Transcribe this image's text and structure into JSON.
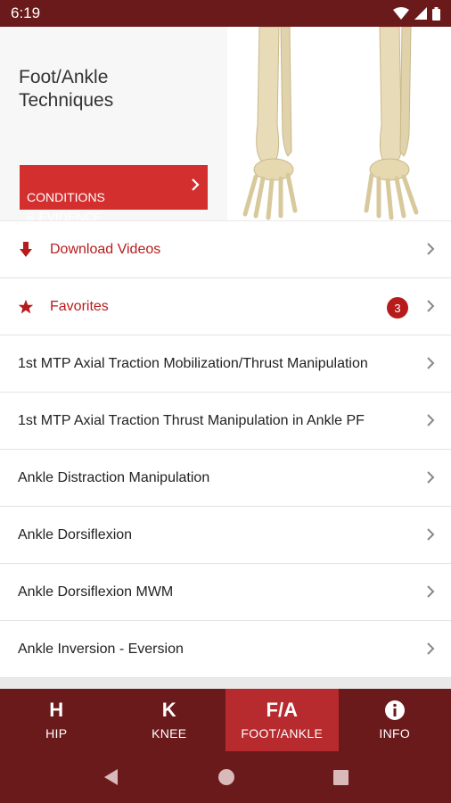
{
  "status_bar": {
    "time": "6:19",
    "icons": [
      "wifi-icon",
      "signal-icon",
      "battery-icon"
    ]
  },
  "hero": {
    "title": "Foot/Ankle\nTechniques",
    "button_label": "CONDITIONS\n& EVIDENCE"
  },
  "list": {
    "download_label": "Download Videos",
    "favorites_label": "Favorites",
    "favorites_count": "3",
    "items": [
      "1st MTP Axial Traction Mobilization/Thrust Manipulation",
      "1st MTP Axial Traction Thrust Manipulation in Ankle PF",
      "Ankle Distraction Manipulation",
      "Ankle Dorsiflexion",
      "Ankle Dorsiflexion MWM",
      "Ankle Inversion - Eversion"
    ]
  },
  "tabs": [
    {
      "icon": "H",
      "label": "HIP"
    },
    {
      "icon": "K",
      "label": "KNEE"
    },
    {
      "icon": "F/A",
      "label": "FOOT/ANKLE"
    },
    {
      "icon": "info-icon",
      "label": "INFO"
    }
  ],
  "nav": [
    "back-icon",
    "home-icon",
    "recents-icon"
  ],
  "colors": {
    "primary": "#6b1a1c",
    "accent": "#d32f2f",
    "active_tab": "#b72a2d"
  }
}
